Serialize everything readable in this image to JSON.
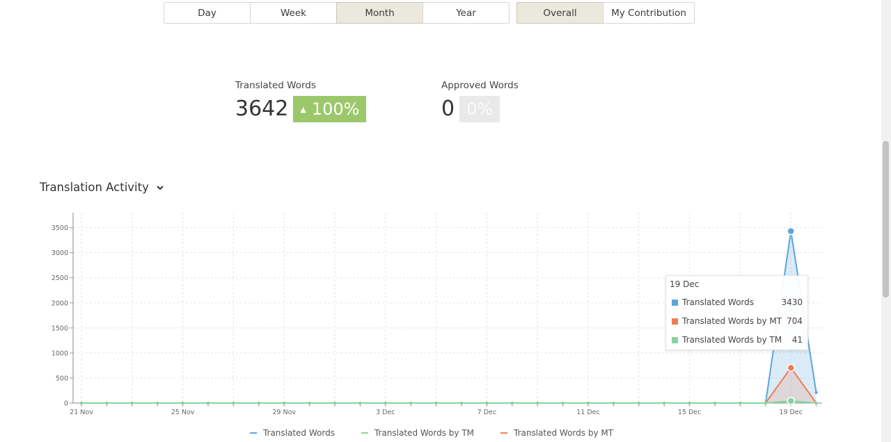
{
  "filters": {
    "period": [
      {
        "label": "Day",
        "active": false
      },
      {
        "label": "Week",
        "active": false
      },
      {
        "label": "Month",
        "active": true
      },
      {
        "label": "Year",
        "active": false
      }
    ],
    "scope": [
      {
        "label": "Overall",
        "active": true
      },
      {
        "label": "My Contribution",
        "active": false
      }
    ]
  },
  "stats": {
    "translated": {
      "label": "Translated Words",
      "value": "3642",
      "change": "100%",
      "change_direction": "up"
    },
    "approved": {
      "label": "Approved Words",
      "value": "0",
      "change": "0%"
    }
  },
  "section": {
    "title": "Translation Activity",
    "icon": "chevron-down-icon"
  },
  "tooltip": {
    "date": "19 Dec",
    "rows": [
      {
        "label": "Translated Words",
        "value": "3430",
        "color": "#5aa6dc"
      },
      {
        "label": "Translated Words by MT",
        "value": "704",
        "color": "#ef7d52"
      },
      {
        "label": "Translated Words by TM",
        "value": "41",
        "color": "#86d3a0"
      }
    ]
  },
  "legend": [
    {
      "label": "Translated Words",
      "color": "#5aa6dc"
    },
    {
      "label": "Translated Words by TM",
      "color": "#86d3a0"
    },
    {
      "label": "Translated Words by MT",
      "color": "#ef7d52"
    }
  ],
  "chart_data": {
    "type": "area",
    "title": "Translation Activity",
    "xlabel": "",
    "ylabel": "",
    "ylim": [
      0,
      3800
    ],
    "yticks": [
      0,
      500,
      1000,
      1500,
      2000,
      2500,
      3000,
      3500
    ],
    "x": [
      "21 Nov",
      "22 Nov",
      "23 Nov",
      "24 Nov",
      "25 Nov",
      "26 Nov",
      "27 Nov",
      "28 Nov",
      "29 Nov",
      "30 Nov",
      "1 Dec",
      "2 Dec",
      "3 Dec",
      "4 Dec",
      "5 Dec",
      "6 Dec",
      "7 Dec",
      "8 Dec",
      "9 Dec",
      "10 Dec",
      "11 Dec",
      "12 Dec",
      "13 Dec",
      "14 Dec",
      "15 Dec",
      "16 Dec",
      "17 Dec",
      "18 Dec",
      "19 Dec",
      "20 Dec"
    ],
    "xtick_labels": [
      "21 Nov",
      "25 Nov",
      "29 Nov",
      "3 Dec",
      "7 Dec",
      "11 Dec",
      "15 Dec",
      "19 Dec"
    ],
    "grid": true,
    "legend_position": "bottom",
    "series": [
      {
        "name": "Translated Words",
        "color": "#5aa6dc",
        "values": [
          0,
          0,
          0,
          0,
          0,
          0,
          0,
          0,
          0,
          0,
          0,
          0,
          0,
          0,
          0,
          0,
          0,
          0,
          0,
          0,
          0,
          0,
          0,
          0,
          0,
          0,
          0,
          0,
          3430,
          212
        ]
      },
      {
        "name": "Translated Words by TM",
        "color": "#86d3a0",
        "values": [
          0,
          0,
          0,
          0,
          0,
          0,
          0,
          0,
          0,
          0,
          0,
          0,
          0,
          0,
          0,
          0,
          0,
          0,
          0,
          0,
          0,
          0,
          0,
          0,
          0,
          0,
          0,
          0,
          41,
          0
        ]
      },
      {
        "name": "Translated Words by MT",
        "color": "#ef7d52",
        "values": [
          0,
          0,
          0,
          0,
          0,
          0,
          0,
          0,
          0,
          0,
          0,
          0,
          0,
          0,
          0,
          0,
          0,
          0,
          0,
          0,
          0,
          0,
          0,
          0,
          0,
          0,
          0,
          0,
          704,
          0
        ]
      }
    ],
    "highlight_index": 28
  }
}
